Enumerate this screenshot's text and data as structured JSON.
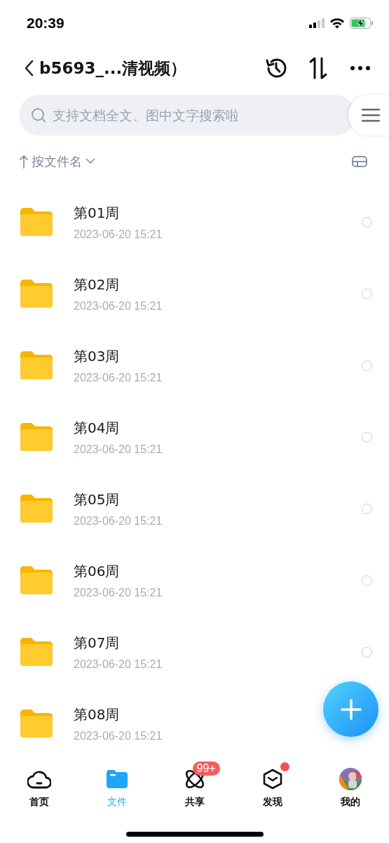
{
  "status_bar": {
    "time": "20:39"
  },
  "header": {
    "title": "b5693_...清视频）"
  },
  "search": {
    "placeholder": "支持文档全文、图中文字搜索啦"
  },
  "sort": {
    "label": "按文件名"
  },
  "files": [
    {
      "name": "第01周",
      "date": "2023-06-20 15:21",
      "checked": false
    },
    {
      "name": "第02周",
      "date": "2023-06-20 15:21",
      "checked": false
    },
    {
      "name": "第03周",
      "date": "2023-06-20 15:21",
      "checked": false
    },
    {
      "name": "第04周",
      "date": "2023-06-20 15:21",
      "checked": false
    },
    {
      "name": "第05周",
      "date": "2023-06-20 15:21",
      "checked": false
    },
    {
      "name": "第06周",
      "date": "2023-06-20 15:21",
      "checked": false
    },
    {
      "name": "第07周",
      "date": "2023-06-20 15:21",
      "checked": false
    },
    {
      "name": "第08周",
      "date": "2023-06-20 15:21"
    }
  ],
  "tabs": [
    {
      "kind": "home",
      "label": "首页",
      "selected": false
    },
    {
      "kind": "files",
      "label": "文件",
      "selected": true
    },
    {
      "kind": "share",
      "label": "共享",
      "selected": false,
      "badge": "99+"
    },
    {
      "kind": "discover",
      "label": "发现",
      "selected": false,
      "dot": true
    },
    {
      "kind": "me",
      "label": "我的",
      "selected": false
    }
  ]
}
